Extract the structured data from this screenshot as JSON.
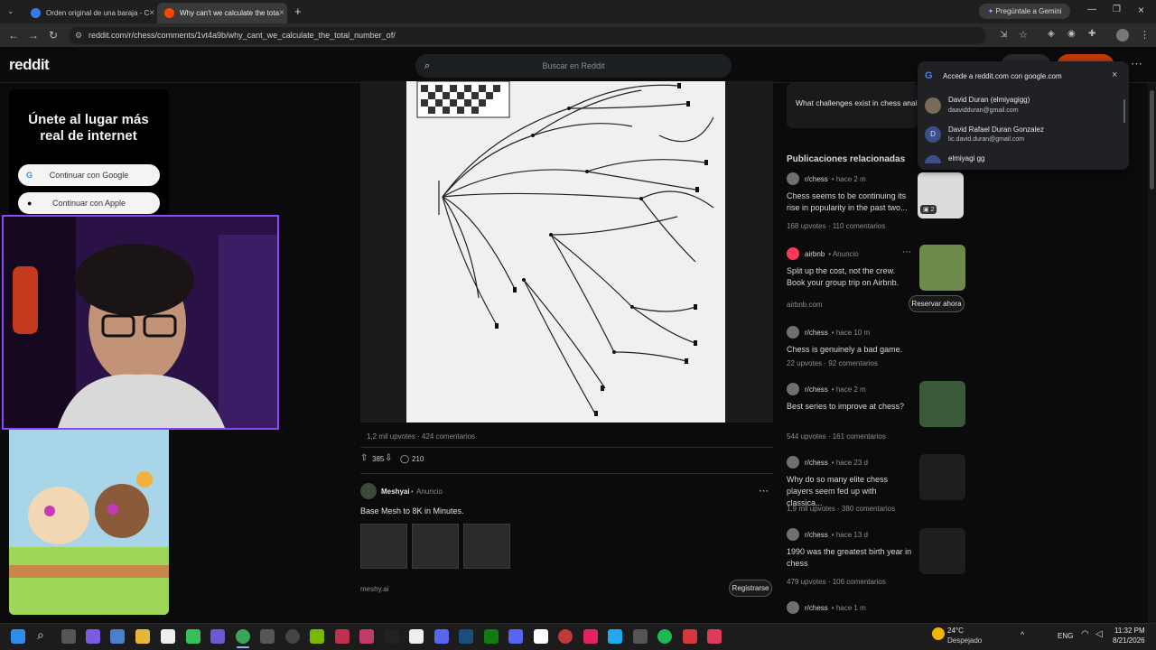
{
  "browser": {
    "tabs": [
      {
        "title": "Orden original de una baraja - C",
        "active": false
      },
      {
        "title": "Why can't we calculate the tota",
        "active": true
      }
    ],
    "new_tab": "+",
    "gemini_label": "Pregúntale a Gemini",
    "url": "reddit.com/r/chess/comments/1vt4a9b/why_cant_we_calculate_the_total_number_of/"
  },
  "reddit": {
    "logo": "reddit",
    "search_placeholder": "Buscar en Reddit"
  },
  "left_promo": {
    "title": "Únete al lugar más real de internet",
    "google_button": "Continuar con Google",
    "apple_button": "Continuar con Apple"
  },
  "post": {
    "image_stats": "1,2 mil upvotes · 424 comentarios",
    "upvotes": "385",
    "comments": "210"
  },
  "ad": {
    "advertiser": "Meshyai",
    "ad_label": "Anuncio",
    "text": "Base Mesh to 8K in Minutes.",
    "domain": "meshy.ai",
    "cta": "Registrarse"
  },
  "right": {
    "top_query": "What challenges exist in chess anal",
    "related_title": "Publicaciones relacionadas",
    "items": [
      {
        "sub": "r/chess",
        "time": "hace 2 m",
        "title": "Chess seems to be continuing its rise in popularity in the past two...",
        "upvotes": "168 upvotes",
        "comments": "110 comentarios",
        "thumb_badge": "2"
      },
      {
        "sub": "airbnb",
        "time": "Anuncio",
        "title": "Split up the cost, not the crew. Book your group trip on Airbnb.",
        "domain": "airbnb.com",
        "cta": "Reservar ahora"
      },
      {
        "sub": "r/chess",
        "time": "hace 10 m",
        "title": "Chess is genuinely a bad game.",
        "upvotes": "22 upvotes",
        "comments": "92 comentarios"
      },
      {
        "sub": "r/chess",
        "time": "hace 2 m",
        "title": "Best series to improve at chess?",
        "upvotes": "544 upvotes",
        "comments": "161 comentarios"
      },
      {
        "sub": "r/chess",
        "time": "hace 23 d",
        "title": "Why do so many elite chess players seem fed up with classica...",
        "upvotes": "1,9 mil upvotes",
        "comments": "380 comentarios"
      },
      {
        "sub": "r/chess",
        "time": "hace 13 d",
        "title": "1990 was the greatest birth year in chess",
        "upvotes": "479 upvotes",
        "comments": "106 comentarios"
      },
      {
        "sub": "r/chess",
        "time": "hace 1 m"
      }
    ]
  },
  "google_popup": {
    "title": "Accede a reddit.com con google.com",
    "accounts": [
      {
        "name": "David Duran (elmiyagigg)",
        "email": "daavidduran@gmail.com"
      },
      {
        "name": "David Rafael Duran Gonzalez",
        "email": "lic.david.duran@gmail.com",
        "initial": "D"
      },
      {
        "name": "elmiyagi gg",
        "email": ""
      }
    ]
  },
  "taskbar": {
    "temp": "24°C",
    "weather": "Despejado",
    "lang": "ENG",
    "time": "11:32 PM",
    "date": "8/21/2026"
  },
  "colors": {
    "accent": "#8a4af3",
    "reddit_orange": "#ff4500"
  }
}
